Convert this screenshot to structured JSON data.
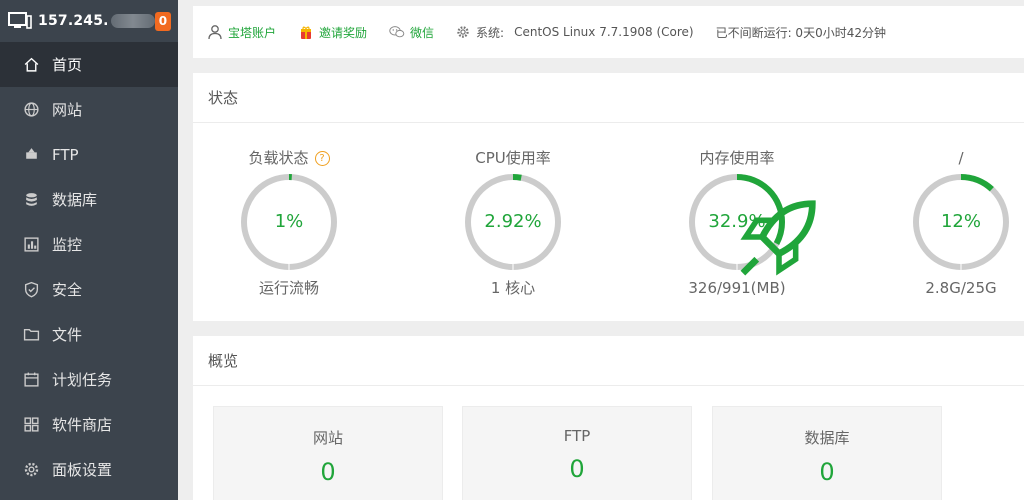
{
  "sidebar": {
    "server_ip": "157.245.",
    "badge_count": "0",
    "items": [
      {
        "label": "首页",
        "icon": "home-icon",
        "active": true
      },
      {
        "label": "网站",
        "icon": "globe-icon"
      },
      {
        "label": "FTP",
        "icon": "ftp-icon"
      },
      {
        "label": "数据库",
        "icon": "database-icon"
      },
      {
        "label": "监控",
        "icon": "monitor-icon"
      },
      {
        "label": "安全",
        "icon": "shield-icon"
      },
      {
        "label": "文件",
        "icon": "folder-icon"
      },
      {
        "label": "计划任务",
        "icon": "calendar-icon"
      },
      {
        "label": "软件商店",
        "icon": "apps-icon"
      },
      {
        "label": "面板设置",
        "icon": "gear-icon"
      }
    ]
  },
  "topbar": {
    "account_label": "宝塔账户",
    "invite_label": "邀请奖励",
    "wechat_label": "微信",
    "system_label": "系统:",
    "system_value": "CentOS Linux 7.7.1908 (Core)",
    "uptime_text": "已不间断运行: 0天0小时42分钟"
  },
  "status": {
    "title": "状态",
    "gauges": [
      {
        "title": "负载状态",
        "percent": 1,
        "value_text": "1%",
        "sub": "运行流畅",
        "has_help": true
      },
      {
        "title": "CPU使用率",
        "percent": 2.92,
        "value_text": "2.92%",
        "sub": "1 核心"
      },
      {
        "title": "内存使用率",
        "percent": 32.9,
        "value_text": "32.9%",
        "sub": "326/991(MB)",
        "has_rocket": true
      },
      {
        "title": "/",
        "percent": 12,
        "value_text": "12%",
        "sub": "2.8G/25G"
      }
    ]
  },
  "overview": {
    "title": "概览",
    "cards": [
      {
        "label": "网站",
        "value": "0"
      },
      {
        "label": "FTP",
        "value": "0"
      },
      {
        "label": "数据库",
        "value": "0"
      }
    ]
  },
  "colors": {
    "accent": "#20a53a",
    "sidebar_bg": "#3c444d",
    "sidebar_active": "#2c3138",
    "badge": "#f26a20",
    "ring_track": "#cccccc"
  }
}
